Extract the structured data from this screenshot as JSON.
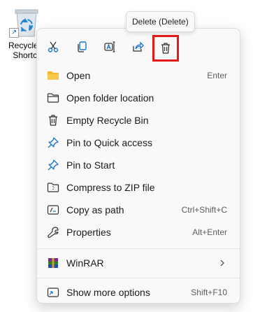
{
  "desktop": {
    "shortcut_label_line1": "Recycle B",
    "shortcut_label_line2": "Shortcu"
  },
  "tooltip": {
    "text": "Delete (Delete)"
  },
  "toolbar": {
    "buttons": [
      {
        "name": "cut",
        "icon": "scissors-icon"
      },
      {
        "name": "copy",
        "icon": "copy-icon"
      },
      {
        "name": "rename",
        "icon": "rename-icon"
      },
      {
        "name": "share",
        "icon": "share-icon"
      },
      {
        "name": "delete",
        "icon": "trash-icon"
      }
    ],
    "highlight_color": "#e21a1a"
  },
  "menu": {
    "items": [
      {
        "label": "Open",
        "shortcut": "Enter",
        "icon": "folder-icon"
      },
      {
        "label": "Open folder location",
        "shortcut": "",
        "icon": "folder-outline-icon"
      },
      {
        "label": "Empty Recycle Bin",
        "shortcut": "",
        "icon": "trash-icon"
      },
      {
        "label": "Pin to Quick access",
        "shortcut": "",
        "icon": "pin-icon"
      },
      {
        "label": "Pin to Start",
        "shortcut": "",
        "icon": "pin-icon"
      },
      {
        "label": "Compress to ZIP file",
        "shortcut": "",
        "icon": "zip-icon"
      },
      {
        "label": "Copy as path",
        "shortcut": "Ctrl+Shift+C",
        "icon": "path-icon"
      },
      {
        "label": "Properties",
        "shortcut": "Alt+Enter",
        "icon": "wrench-icon"
      },
      {
        "label": "WinRAR",
        "shortcut": "",
        "icon": "winrar-icon",
        "submenu": true
      },
      {
        "label": "Show more options",
        "shortcut": "Shift+F10",
        "icon": "more-options-icon"
      }
    ]
  },
  "colors": {
    "accent_blue": "#1a73c8",
    "folder_yellow": "#f2b632"
  }
}
